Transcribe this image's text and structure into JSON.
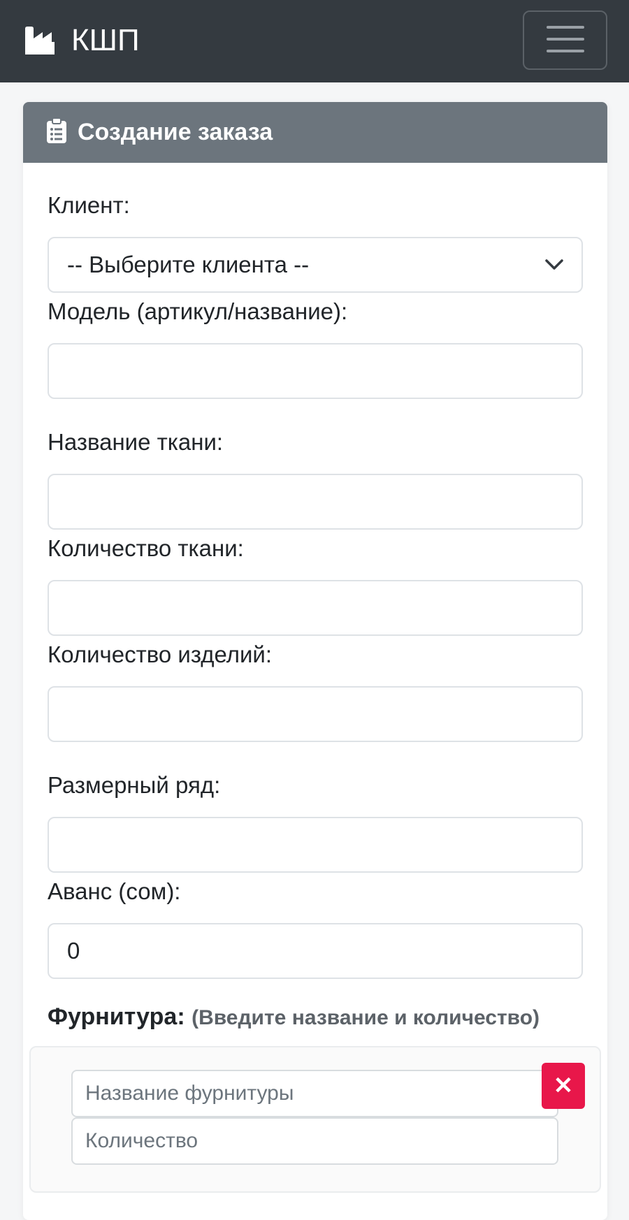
{
  "navbar": {
    "brand": "КШП",
    "brand_icon": "industry-icon",
    "menu_icon": "hamburger-menu-icon"
  },
  "card": {
    "title": "Создание заказа",
    "title_icon": "clipboard-list-icon"
  },
  "form": {
    "client_label": "Клиент:",
    "client_select_value": "-- Выберите клиента --",
    "model_label": "Модель (артикул/название):",
    "model_value": "",
    "fabric_name_label": "Название ткани:",
    "fabric_name_value": "",
    "fabric_qty_label": "Количество ткани:",
    "fabric_qty_value": "",
    "items_qty_label": "Количество изделий:",
    "items_qty_value": "",
    "size_range_label": "Размерный ряд:",
    "size_range_value": "",
    "advance_label": "Аванс (сом):",
    "advance_value": "0"
  },
  "furniture": {
    "title": "Фурнитура:",
    "hint": "(Введите название и количество)",
    "name_placeholder": "Название фурнитуры",
    "qty_placeholder": "Количество",
    "remove_label": "✕"
  },
  "colors": {
    "navbar_bg": "#343a40",
    "card_header_bg": "#6c757d",
    "danger": "#e8174a"
  }
}
